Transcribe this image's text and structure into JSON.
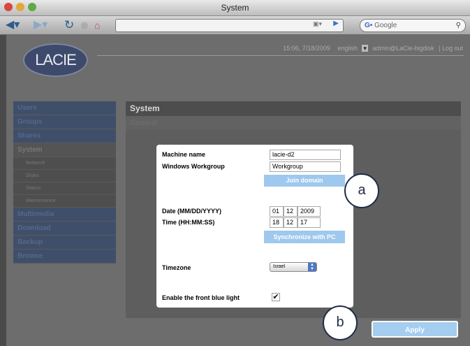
{
  "window": {
    "title": "System"
  },
  "toolbar": {
    "search_placeholder": "Google",
    "search_prefix": "G•"
  },
  "header": {
    "logo_text": "LACIE",
    "datetime": "15:06, 7/18/2009",
    "language": "english",
    "user": "admin@LaCie-bigdisk",
    "logout": "| Log out"
  },
  "sidebar": {
    "items": [
      {
        "label": "Users"
      },
      {
        "label": "Groups"
      },
      {
        "label": "Shares"
      },
      {
        "label": "System"
      },
      {
        "label": "Network"
      },
      {
        "label": "Disks"
      },
      {
        "label": "Status"
      },
      {
        "label": "Maintenance"
      },
      {
        "label": "Multimedia"
      },
      {
        "label": "Download"
      },
      {
        "label": "Backup"
      },
      {
        "label": "Browse"
      }
    ]
  },
  "content": {
    "title": "System",
    "subtitle": "General"
  },
  "dialog": {
    "machine_name_label": "Machine name",
    "machine_name_value": "lacie-d2",
    "workgroup_label": "Windows Workgroup",
    "workgroup_value": "Workgroup",
    "join_domain": "Join domain",
    "date_label": "Date (MM/DD/YYYY)",
    "date_month": "01",
    "date_day": "12",
    "date_year": "2009",
    "time_label": "Time (HH:MM:SS)",
    "time_hh": "18",
    "time_mm": "12",
    "time_ss": "17",
    "sync_pc": "Synchronize with PC",
    "timezone_label": "Timezone",
    "timezone_value": "Israel",
    "blue_light_label": "Enable the front blue light",
    "blue_light_checked": "✔"
  },
  "callouts": {
    "a": "a",
    "b": "b"
  },
  "apply": "Apply",
  "colors": {
    "accent": "#9ec8ee",
    "callout_border": "#1f2b48"
  }
}
